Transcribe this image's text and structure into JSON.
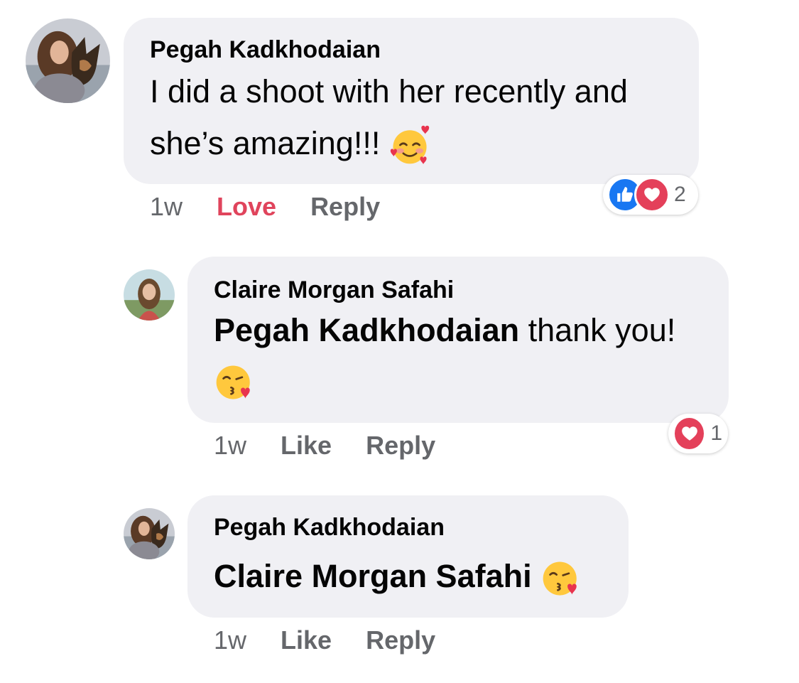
{
  "comments": [
    {
      "author": "Pegah Kadkhodaian",
      "line1": "I did a shoot with her recently and",
      "line2": "she’s amazing!!!",
      "emoji": "smiling-face-with-hearts",
      "time": "1w",
      "action_primary": "Love",
      "action_reply": "Reply",
      "reactions": {
        "icons": [
          "like",
          "love"
        ],
        "count": "2"
      },
      "colors": {
        "love_active": "#e0445c"
      }
    },
    {
      "author": "Claire Morgan Safahi",
      "mention": "Pegah Kadkhodaian",
      "line1_rest": " thank you!",
      "emoji": "face-blowing-a-kiss",
      "time": "1w",
      "action_primary": "Like",
      "action_reply": "Reply",
      "reactions": {
        "icons": [
          "love"
        ],
        "count": "1"
      }
    },
    {
      "author": "Pegah Kadkhodaian",
      "mention": "Claire Morgan Safahi",
      "emoji": "face-blowing-a-kiss",
      "time": "1w",
      "action_primary": "Like",
      "action_reply": "Reply"
    }
  ],
  "colors": {
    "bubble_bg": "#f0f0f4",
    "meta_text": "#65676b",
    "like_blue": "#1877f2",
    "love_red": "#e4405a"
  }
}
